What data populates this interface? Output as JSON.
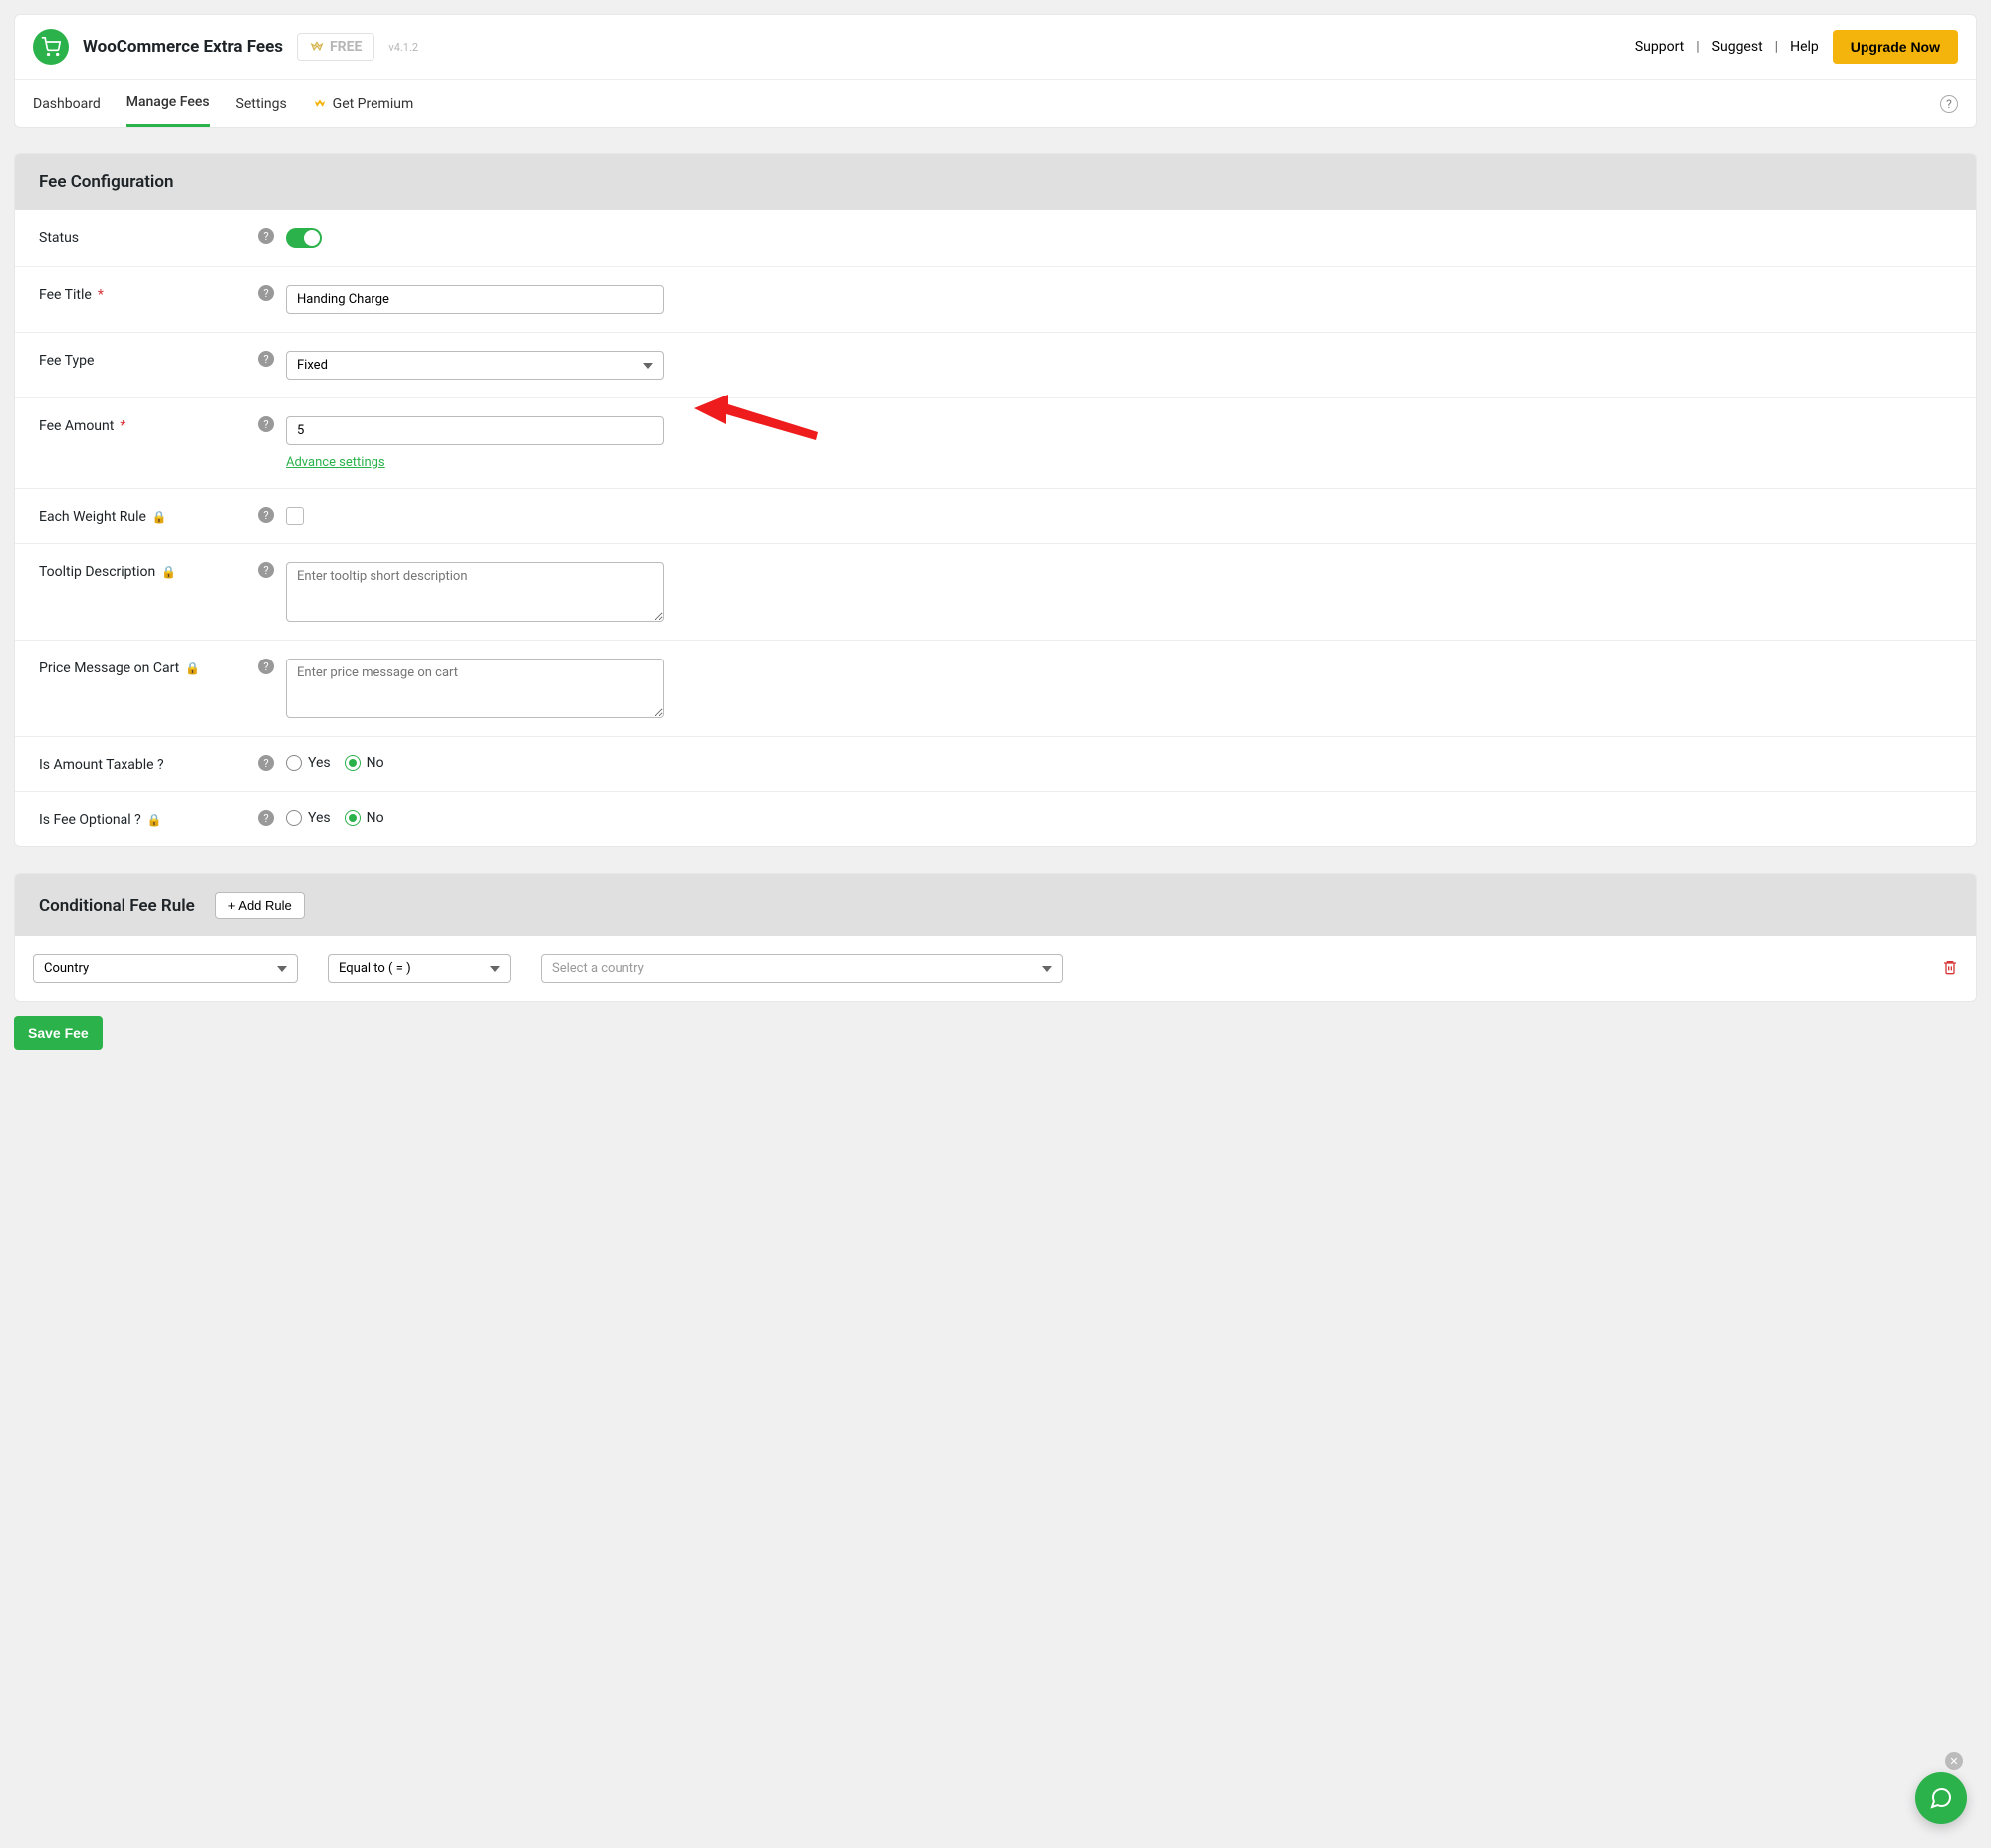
{
  "header": {
    "app_title": "WooCommerce Extra Fees",
    "free_badge": "FREE",
    "version": "v4.1.2",
    "links": {
      "support": "Support",
      "suggest": "Suggest",
      "help": "Help"
    },
    "upgrade": "Upgrade Now"
  },
  "tabs": {
    "dashboard": "Dashboard",
    "manage_fees": "Manage Fees",
    "settings": "Settings",
    "get_premium": "Get Premium"
  },
  "fee_config": {
    "title": "Fee Configuration",
    "status_label": "Status",
    "status_on": true,
    "fee_title_label": "Fee Title",
    "fee_title_value": "Handing Charge",
    "fee_type_label": "Fee Type",
    "fee_type_value": "Fixed",
    "fee_amount_label": "Fee Amount",
    "fee_amount_value": "5",
    "advance_settings": "Advance settings",
    "each_weight_label": "Each Weight Rule",
    "tooltip_label": "Tooltip Description",
    "tooltip_placeholder": "Enter tooltip short description",
    "price_msg_label": "Price Message on Cart",
    "price_msg_placeholder": "Enter price message on cart",
    "taxable_label": "Is Amount Taxable ?",
    "optional_label": "Is Fee Optional ?",
    "yes": "Yes",
    "no": "No"
  },
  "rule": {
    "title": "Conditional Fee Rule",
    "add_rule": "+ Add Rule",
    "field": "Country",
    "operator": "Equal to ( = )",
    "value_placeholder": "Select a country"
  },
  "save": "Save Fee"
}
